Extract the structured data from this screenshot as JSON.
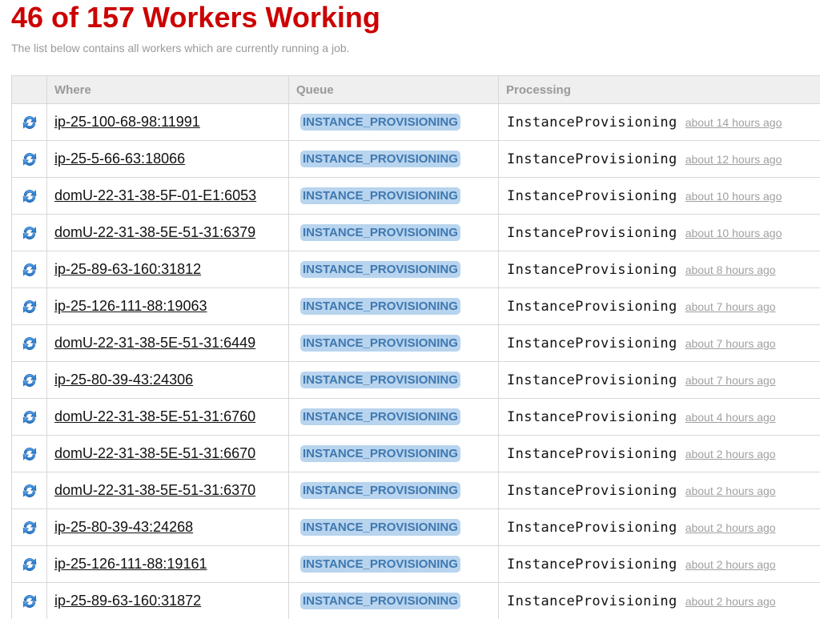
{
  "header": {
    "title": "46 of 157 Workers Working",
    "subtitle": "The list below contains all workers which are currently running a job."
  },
  "table": {
    "columns": {
      "icon": "",
      "where": "Where",
      "queue": "Queue",
      "processing": "Processing"
    },
    "row_icon": "refresh-icon",
    "rows": [
      {
        "where": "ip-25-100-68-98:11991",
        "queue": "INSTANCE_PROVISIONING",
        "job": "InstanceProvisioning",
        "time": "about 14 hours ago"
      },
      {
        "where": "ip-25-5-66-63:18066",
        "queue": "INSTANCE_PROVISIONING",
        "job": "InstanceProvisioning",
        "time": "about 12 hours ago"
      },
      {
        "where": "domU-22-31-38-5F-01-E1:6053",
        "queue": "INSTANCE_PROVISIONING",
        "job": "InstanceProvisioning",
        "time": "about 10 hours ago"
      },
      {
        "where": "domU-22-31-38-5E-51-31:6379",
        "queue": "INSTANCE_PROVISIONING",
        "job": "InstanceProvisioning",
        "time": "about 10 hours ago"
      },
      {
        "where": "ip-25-89-63-160:31812",
        "queue": "INSTANCE_PROVISIONING",
        "job": "InstanceProvisioning",
        "time": "about 8 hours ago"
      },
      {
        "where": "ip-25-126-111-88:19063",
        "queue": "INSTANCE_PROVISIONING",
        "job": "InstanceProvisioning",
        "time": "about 7 hours ago"
      },
      {
        "where": "domU-22-31-38-5E-51-31:6449",
        "queue": "INSTANCE_PROVISIONING",
        "job": "InstanceProvisioning",
        "time": "about 7 hours ago"
      },
      {
        "where": "ip-25-80-39-43:24306",
        "queue": "INSTANCE_PROVISIONING",
        "job": "InstanceProvisioning",
        "time": "about 7 hours ago"
      },
      {
        "where": "domU-22-31-38-5E-51-31:6760",
        "queue": "INSTANCE_PROVISIONING",
        "job": "InstanceProvisioning",
        "time": "about 4 hours ago"
      },
      {
        "where": "domU-22-31-38-5E-51-31:6670",
        "queue": "INSTANCE_PROVISIONING",
        "job": "InstanceProvisioning",
        "time": "about 2 hours ago"
      },
      {
        "where": "domU-22-31-38-5E-51-31:6370",
        "queue": "INSTANCE_PROVISIONING",
        "job": "InstanceProvisioning",
        "time": "about 2 hours ago"
      },
      {
        "where": "ip-25-80-39-43:24268",
        "queue": "INSTANCE_PROVISIONING",
        "job": "InstanceProvisioning",
        "time": "about 2 hours ago"
      },
      {
        "where": "ip-25-126-111-88:19161",
        "queue": "INSTANCE_PROVISIONING",
        "job": "InstanceProvisioning",
        "time": "about 2 hours ago"
      },
      {
        "where": "ip-25-89-63-160:31872",
        "queue": "INSTANCE_PROVISIONING",
        "job": "InstanceProvisioning",
        "time": "about 2 hours ago"
      }
    ]
  },
  "colors": {
    "title": "#cc0000",
    "subtitle": "#999999",
    "header_bg": "#efefef",
    "badge_bg": "#b8d4ee",
    "badge_text": "#3f78b0",
    "time_text": "#a0a0a0"
  }
}
